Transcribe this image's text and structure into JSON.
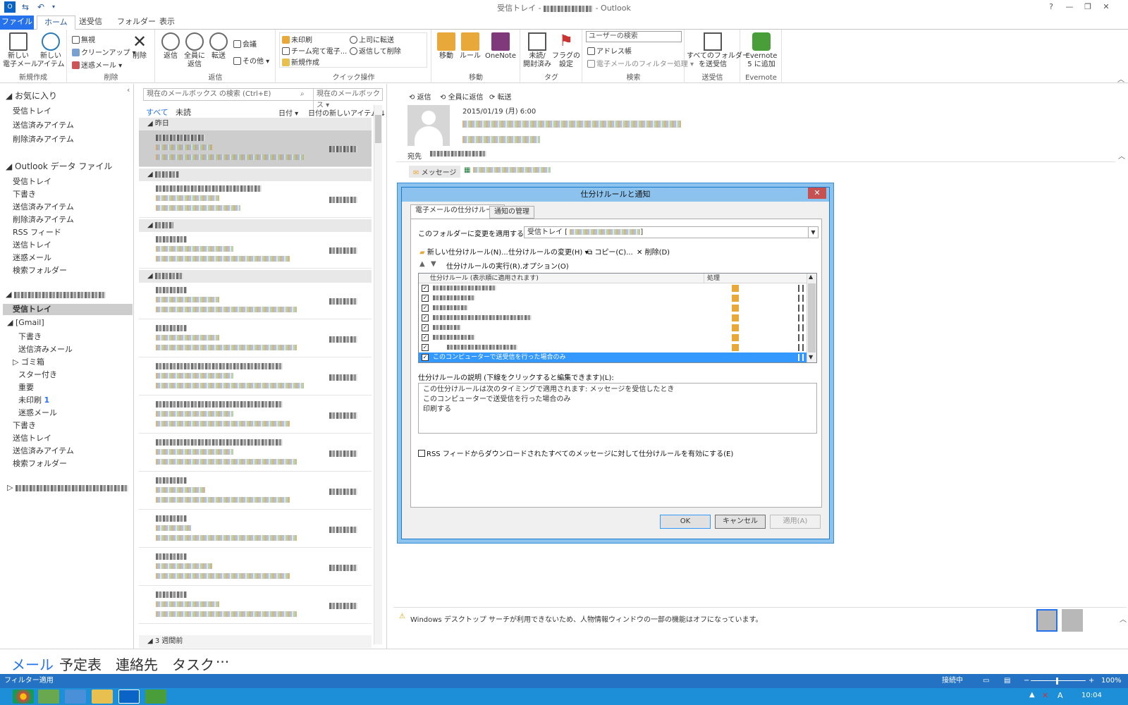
{
  "window": {
    "title_suffix": "受信トレイ - ",
    "app": "- Outlook",
    "help": "?",
    "min": "—",
    "max": "❐",
    "close": "✕"
  },
  "tabs": [
    "ファイル",
    "ホーム",
    "送受信",
    "フォルダー",
    "表示"
  ],
  "ribbon": {
    "new_email": "新しい\n電子メール",
    "new_items": "新しい\nアイテム",
    "group_new": "新規作成",
    "ignore": "無視",
    "cleanup": "クリーンアップ ▾",
    "junk": "迷惑メール ▾",
    "delete": "削除",
    "group_delete": "削除",
    "reply": "返信",
    "reply_all": "全員に\n返信",
    "forward": "転送",
    "meeting": "会議",
    "more": "その他 ▾",
    "group_respond": "返信",
    "qs1": "未印刷",
    "qs2": "チーム宛て電子...",
    "qs3": "新規作成",
    "qs4": "上司に転送",
    "qs5": "返信して削除",
    "group_quick": "クイック操作",
    "move": "移動",
    "rules": "ルール",
    "onenote": "OneNote",
    "group_move": "移動",
    "unread": "未読/\n開封済み",
    "flag": "フラグの\n設定",
    "group_tags": "タグ",
    "search_people": "ユーザーの検索",
    "address_book": "アドレス帳",
    "filter_email": "電子メールのフィルター処理 ▾",
    "group_find": "検索",
    "send_receive_all": "すべてのフォルダー\nを送受信",
    "group_send": "送受信",
    "evernote": "Evernote\n5 に追加",
    "group_evernote": "Evernote"
  },
  "folders": {
    "favorites": "お気に入り",
    "fav_items": [
      "受信トレイ",
      "送信済みアイテム",
      "削除済みアイテム"
    ],
    "data_file": "Outlook データ ファイル",
    "data_items": [
      "受信トレイ",
      "下書き",
      "送信済みアイテム",
      "削除済みアイテム",
      "RSS フィード",
      "送信トレイ",
      "迷惑メール",
      "検索フォルダー"
    ],
    "account_inbox": "受信トレイ",
    "gmail": "[Gmail]",
    "gmail_items": [
      "下書き",
      "送信済みメール",
      "ゴミ箱",
      "スター付き",
      "重要",
      "未印刷",
      "迷惑メール"
    ],
    "unread_count": "1",
    "account_items": [
      "下書き",
      "送信トレイ",
      "送信済みアイテム",
      "検索フォルダー"
    ]
  },
  "msglist": {
    "search_placeholder": "現在のメールボックス の検索 (Ctrl+E)",
    "scope": "現在のメールボックス ▾",
    "filter_all": "すべて",
    "filter_unread": "未読",
    "sort_by": "日付 ▾",
    "sort_order": "日付の新しいアイテム ↓",
    "group_yesterday": "昨日",
    "group_3weeks": "3 週間前"
  },
  "reading": {
    "reply": "返信",
    "reply_all": "全員に返信",
    "forward": "転送",
    "date": "2015/01/19 (月) 6:00",
    "to_label": "宛先",
    "attachment_msg": "メッセージ",
    "warning": "Windows デスクトップ サーチが利用できないため、人物情報ウィンドウの一部の機能はオフになっています。"
  },
  "dialog": {
    "title": "仕分けルールと通知",
    "close": "✕",
    "tab_rules": "電子メールの仕分けルール",
    "tab_alerts": "通知の管理",
    "apply_to_label": "このフォルダーに変更を適用する(F):",
    "apply_to_value": "受信トレイ [",
    "apply_to_end": "]",
    "new_rule": "新しい仕分けルール(N)...",
    "change_rule": "仕分けルールの変更(H) ▾",
    "copy": "コピー(C)...",
    "delete": "削除(D)",
    "run_rules": "仕分けルールの実行(R)...",
    "options": "オプション(O)",
    "col_rule": "仕分けルール (表示順に適用されます)",
    "col_action": "処理",
    "selected_rule": "このコンピューターで送受信を行った場合のみ",
    "desc_label": "仕分けルールの説明 (下線をクリックすると編集できます)(L):",
    "desc_lines": [
      "この仕分けルールは次のタイミングで適用されます: メッセージを受信したとき",
      "このコンピューターで送受信を行った場合のみ",
      "印刷する"
    ],
    "rss_option": "RSS フィードからダウンロードされたすべてのメッセージに対して仕分けルールを有効にする(E)",
    "ok": "OK",
    "cancel": "キャンセル",
    "apply": "適用(A)"
  },
  "nav": {
    "mail": "メール",
    "calendar": "予定表",
    "people": "連絡先",
    "tasks": "タスク",
    "more": "···"
  },
  "status": {
    "filter": "フィルター適用",
    "connected": "接続中",
    "zoom": "100%"
  },
  "clock": "10:04",
  "colors": {
    "accent": "#2672ec",
    "status": "#2372c4",
    "taskbar": "#1d8fd8",
    "selection": "#3399ff"
  }
}
